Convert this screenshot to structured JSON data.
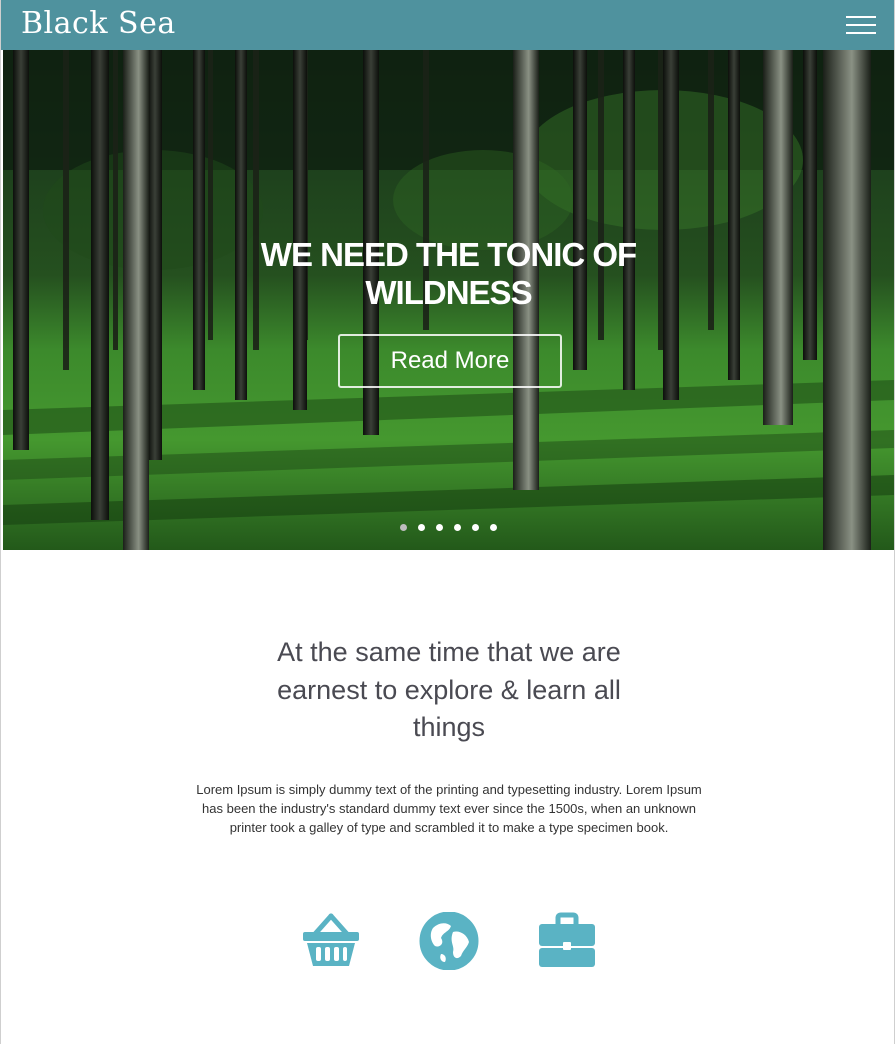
{
  "header": {
    "brand": "Black Sea",
    "menu_icon": "hamburger-menu-icon",
    "background": "#4f929e"
  },
  "hero": {
    "title_line1": "WE NEED THE TONIC OF",
    "title_line2": "WILDNESS",
    "button_label": "Read More",
    "slides": 6,
    "active_slide": 1
  },
  "intro": {
    "heading_line1": "At the same time that we are",
    "heading_line2": "earnest to explore & learn all",
    "heading_line3": "things",
    "body_line1": "Lorem Ipsum is simply dummy text of the printing and typesetting industry. Lorem Ipsum",
    "body_line2": "has been the industry's standard dummy text ever since the 1500s, when an unknown",
    "body_line3": "printer took a galley of type and scrambled it to make a type specimen book."
  },
  "features": {
    "icons": [
      "basket-icon",
      "globe-icon",
      "briefcase-icon"
    ],
    "icon_color": "#5ab3c4"
  }
}
